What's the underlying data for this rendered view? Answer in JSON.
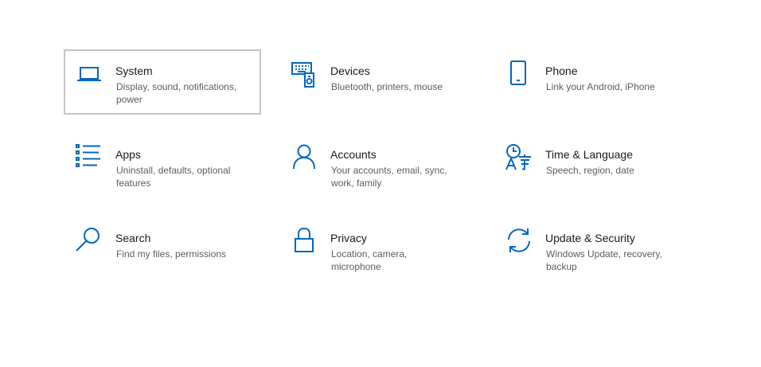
{
  "accent_color": "#0067c0",
  "tiles": [
    {
      "key": "system",
      "icon": "laptop-icon",
      "title": "System",
      "description": "Display, sound, notifications, power",
      "selected": true
    },
    {
      "key": "devices",
      "icon": "devices-icon",
      "title": "Devices",
      "description": "Bluetooth, printers, mouse",
      "selected": false
    },
    {
      "key": "phone",
      "icon": "phone-icon",
      "title": "Phone",
      "description": "Link your Android, iPhone",
      "selected": false
    },
    {
      "key": "apps",
      "icon": "apps-list-icon",
      "title": "Apps",
      "description": "Uninstall, defaults, optional features",
      "selected": false
    },
    {
      "key": "accounts",
      "icon": "person-icon",
      "title": "Accounts",
      "description": "Your accounts, email, sync, work, family",
      "selected": false
    },
    {
      "key": "time-language",
      "icon": "time-language-icon",
      "title": "Time & Language",
      "description": "Speech, region, date",
      "selected": false
    },
    {
      "key": "search",
      "icon": "search-icon",
      "title": "Search",
      "description": "Find my files, permissions",
      "selected": false
    },
    {
      "key": "privacy",
      "icon": "lock-icon",
      "title": "Privacy",
      "description": "Location, camera, microphone",
      "selected": false
    },
    {
      "key": "update-security",
      "icon": "sync-icon",
      "title": "Update & Security",
      "description": "Windows Update, recovery, backup",
      "selected": false
    }
  ]
}
